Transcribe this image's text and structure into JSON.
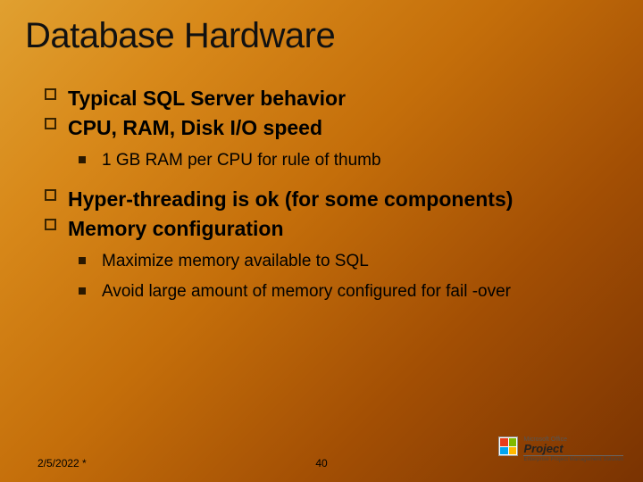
{
  "title": "Database Hardware",
  "bullets": {
    "b1": "Typical SQL Server behavior",
    "b2": "CPU, RAM, Disk I/O speed",
    "b2_1": "1 GB RAM per CPU for rule of thumb",
    "b3": "Hyper-threading is ok (for some components)",
    "b4": "Memory configuration",
    "b4_1": "Maximize memory available to SQL",
    "b4_2": "Avoid large amount of memory configured for fail -over"
  },
  "footer": {
    "date": "2/5/2022 *",
    "page": "40"
  },
  "logo": {
    "ms": "Microsoft Office",
    "product": "Project",
    "subtitle": "Enterprise Project Management Solution"
  }
}
